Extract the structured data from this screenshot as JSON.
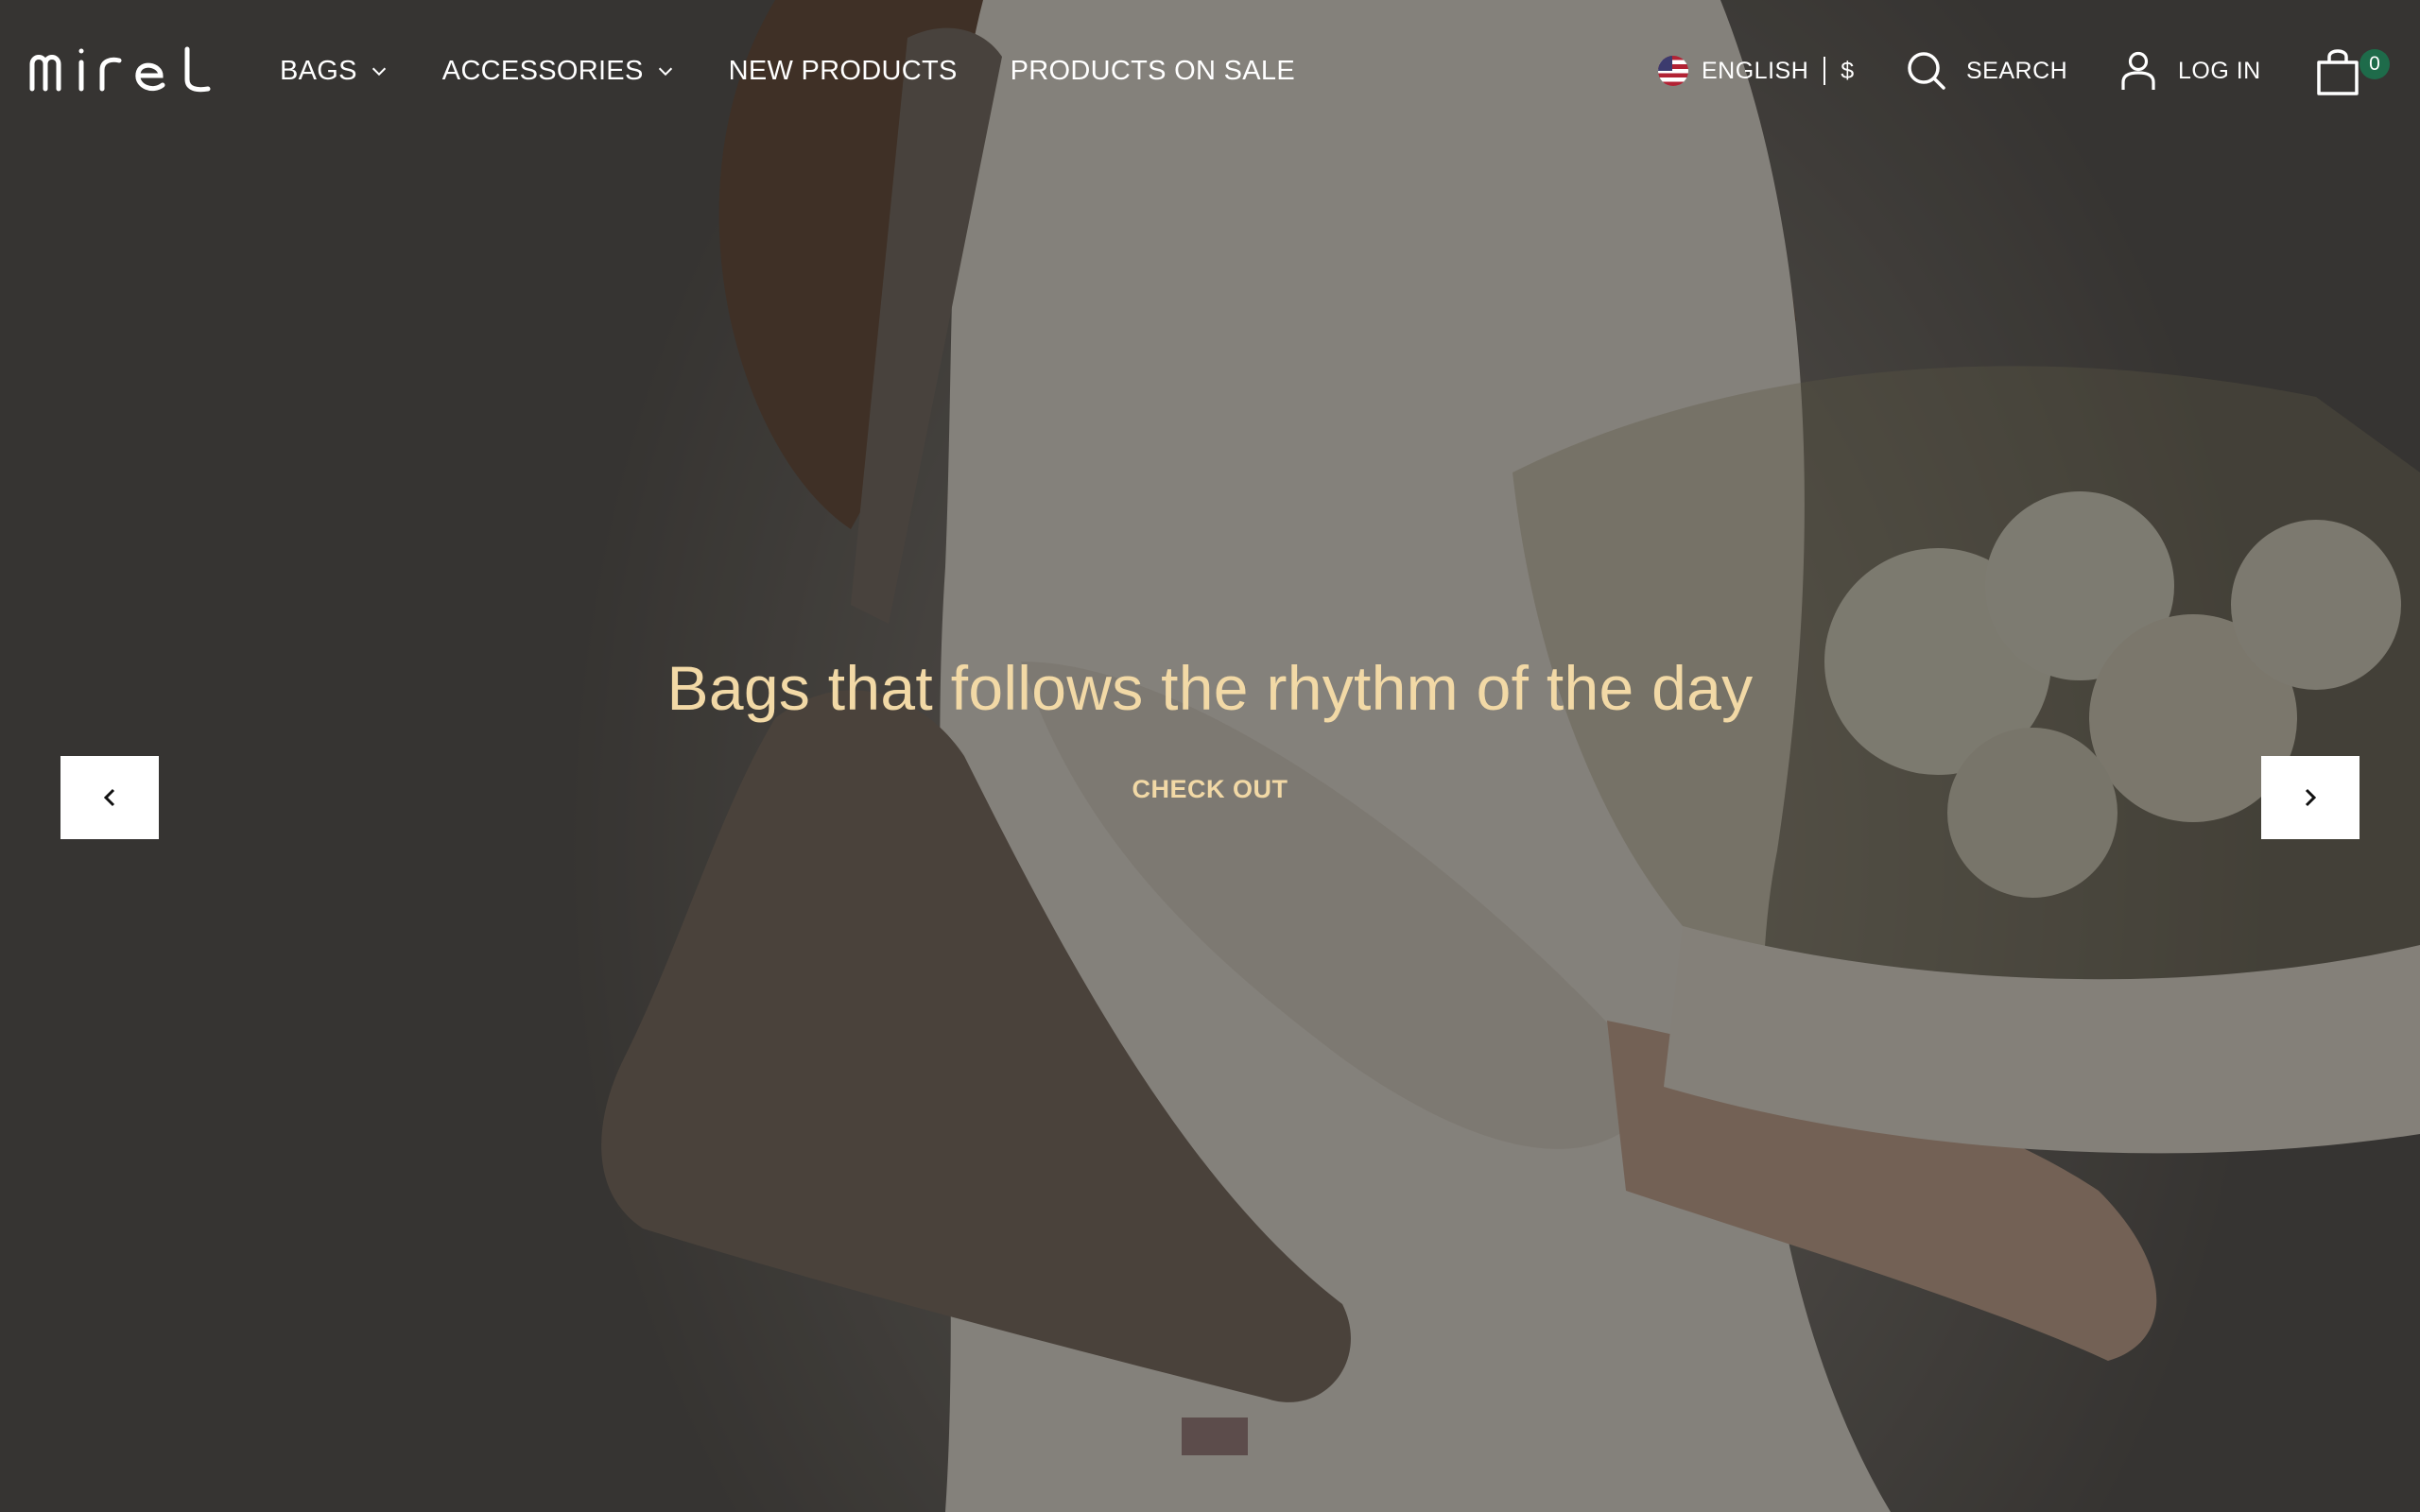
{
  "brand": {
    "logo_text": "mirel"
  },
  "nav": {
    "items": [
      {
        "label": "BAGS",
        "has_dropdown": true
      },
      {
        "label": "ACCESSORIES",
        "has_dropdown": true
      },
      {
        "label": "NEW PRODUCTS",
        "has_dropdown": false
      },
      {
        "label": "PRODUCTS ON SALE",
        "has_dropdown": false
      }
    ]
  },
  "locale": {
    "language": "ENGLISH",
    "currency": "$",
    "flag_icon": "us-flag-icon"
  },
  "search": {
    "label": "SEARCH",
    "icon": "search-icon"
  },
  "account": {
    "label": "LOG IN",
    "icon": "user-icon"
  },
  "cart": {
    "count": "0",
    "icon": "shopping-bag-icon",
    "badge_color": "#1e6b4a"
  },
  "hero": {
    "headline": "Bags that follows the rhythm of the day",
    "cta_label": "CHECK OUT",
    "text_color": "#f2d9a6",
    "prev_icon": "chevron-left-icon",
    "next_icon": "chevron-right-icon"
  }
}
